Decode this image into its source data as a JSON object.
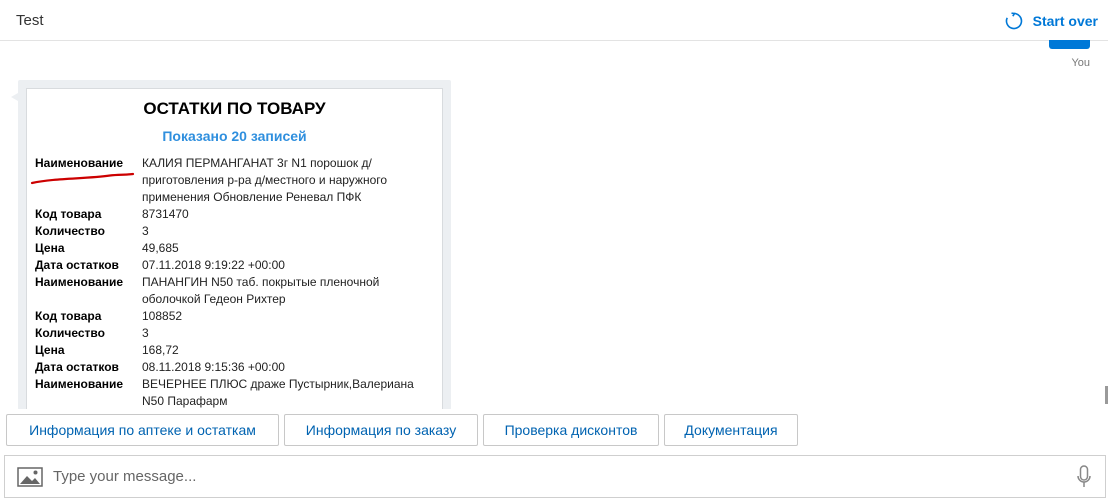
{
  "app": {
    "title": "Test",
    "start_over_label": "Start over"
  },
  "you_label": "You",
  "card": {
    "title": "ОСТАТКИ ПО ТОВАРУ",
    "subtitle": "Показано 20 записей",
    "rows": [
      {
        "k": "Наименование",
        "v": "КАЛИЯ ПЕРМАНГАНАТ 3г N1 порошок д/приготовления р-ра д/местного и наружного применения Обновление Реневал ПФК"
      },
      {
        "k": "Код товара",
        "v": "8731470"
      },
      {
        "k": "Количество",
        "v": "3"
      },
      {
        "k": "Цена",
        "v": "49,685"
      },
      {
        "k": "Дата остатков",
        "v": "07.11.2018 9:19:22 +00:00"
      },
      {
        "k": "Наименование",
        "v": "ПАНАНГИН N50 таб. покрытые пленочной оболочкой Гедеон Рихтер"
      },
      {
        "k": "Код товара",
        "v": "108852"
      },
      {
        "k": "Количество",
        "v": "3"
      },
      {
        "k": "Цена",
        "v": "168,72"
      },
      {
        "k": "Дата остатков",
        "v": "08.11.2018 9:15:36 +00:00"
      },
      {
        "k": "Наименование",
        "v": "ВЕЧЕРНЕЕ ПЛЮС драже Пустырник,Валериана N50 Парафарм"
      }
    ]
  },
  "actions": [
    {
      "label": "Информация по аптеке и остаткам"
    },
    {
      "label": "Информация по заказу"
    },
    {
      "label": "Проверка дисконтов"
    },
    {
      "label": "Документация"
    }
  ],
  "input": {
    "placeholder": "Type your message..."
  },
  "colors": {
    "accent": "#0078d7",
    "subtitle": "#2f8fde",
    "annotation": "#cc0000"
  },
  "icons": {
    "start_over": "refresh-icon",
    "attach": "image-icon",
    "mic": "microphone-icon"
  }
}
